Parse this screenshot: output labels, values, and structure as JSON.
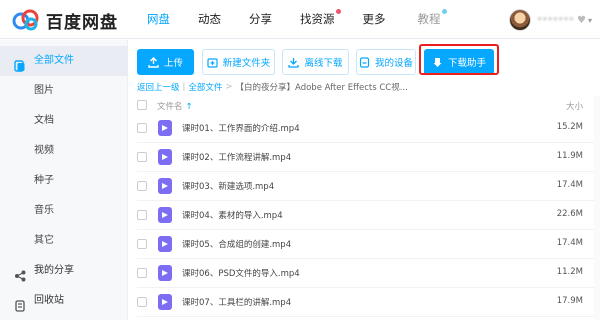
{
  "header": {
    "logo_text": "百度网盘",
    "nav": [
      {
        "label": "网盘",
        "active": true
      },
      {
        "label": "动态"
      },
      {
        "label": "分享"
      },
      {
        "label": "找资源",
        "dot": "#f0566b"
      },
      {
        "label": "更多"
      },
      {
        "label": "教程",
        "dot": "#6fcfee",
        "muted": true
      }
    ],
    "user": {
      "name": "•••••••"
    }
  },
  "sidebar": {
    "items": [
      {
        "label": "全部文件",
        "icon": "files-icon",
        "active": true
      },
      {
        "label": "图片"
      },
      {
        "label": "文档"
      },
      {
        "label": "视频"
      },
      {
        "label": "种子"
      },
      {
        "label": "音乐"
      },
      {
        "label": "其它"
      },
      {
        "label": "我的分享",
        "icon": "share-icon"
      },
      {
        "label": "回收站",
        "icon": "trash-icon"
      }
    ]
  },
  "toolbar": {
    "upload": "上传",
    "new_folder": "新建文件夹",
    "offline": "离线下载",
    "devices": "我的设备",
    "download_helper": "下载助手"
  },
  "breadcrumb": {
    "back": "返回上一级",
    "all": "全部文件",
    "sep": ">",
    "current": "【白的夜分享】Adobe After Effects CC视..."
  },
  "list": {
    "col_name": "文件名",
    "sort_arrow": "↑",
    "col_size": "大小",
    "rows": [
      {
        "name": "课时01、工作界面的介绍.mp4",
        "size": "15.2M"
      },
      {
        "name": "课时02、工作流程讲解.mp4",
        "size": "11.9M"
      },
      {
        "name": "课时03、新建选项.mp4",
        "size": "17.4M"
      },
      {
        "name": "课时04、素材的导入.mp4",
        "size": "22.6M"
      },
      {
        "name": "课时05、合成组的创建.mp4",
        "size": "17.4M"
      },
      {
        "name": "课时06、PSD文件的导入.mp4",
        "size": "11.2M"
      },
      {
        "name": "课时07、工具栏的讲解.mp4",
        "size": "17.9M"
      }
    ]
  },
  "colors": {
    "accent": "#06a7ff",
    "highlight": "#ec1f1f",
    "video_icon": "#7c6df2"
  }
}
